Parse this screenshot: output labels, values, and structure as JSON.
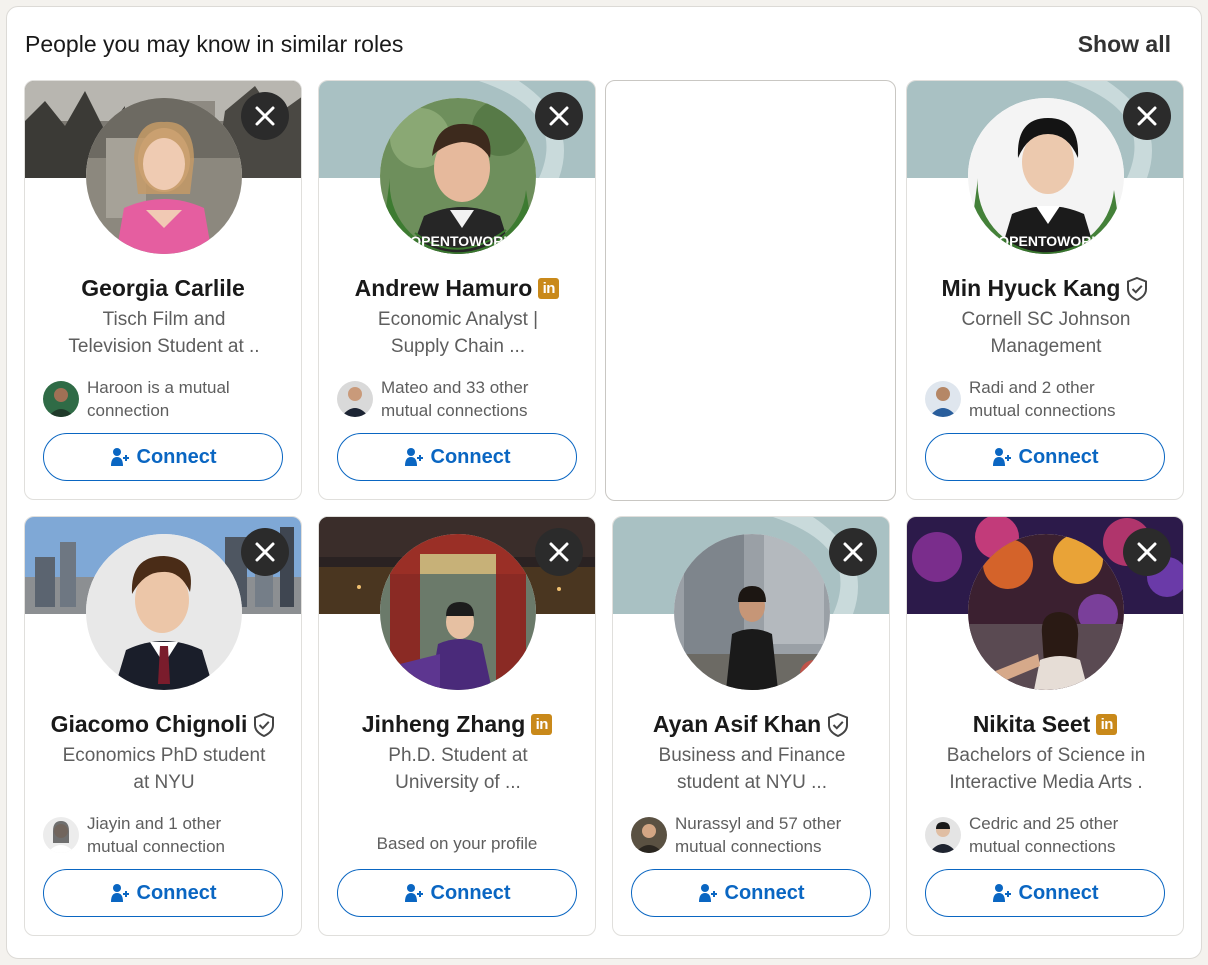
{
  "header": {
    "title": "People you may know in similar roles",
    "show_all_label": "Show all"
  },
  "cards": [
    {
      "name": "Georgia Carlile",
      "badge": "none",
      "headline": [
        "Tisch Film and",
        "Television Student at .."
      ],
      "mutual": [
        "Haroon is a mutual",
        "connection"
      ],
      "connect_label": "Connect"
    },
    {
      "name": "Andrew Hamuro",
      "badge": "linkedin-premium-icon",
      "badge_text": "in",
      "headline": [
        "Economic Analyst |",
        "Supply Chain ..."
      ],
      "mutual": [
        "Mateo and 33 other",
        "mutual connections"
      ],
      "opentowork": "#OPENTOWORK",
      "connect_label": "Connect"
    },
    {
      "name": "Min Hyuck Kang",
      "badge": "verified-shield-icon",
      "headline": [
        "Cornell SC Johnson",
        "Management"
      ],
      "mutual": [
        "Radi and 2 other",
        "mutual connections"
      ],
      "opentowork": "#OPENTOWORK",
      "connect_label": "Connect"
    },
    {
      "name": "Giacomo Chignoli",
      "badge": "verified-shield-icon",
      "headline": [
        "Economics PhD student",
        "at NYU"
      ],
      "mutual": [
        "Jiayin and 1 other",
        "mutual connection"
      ],
      "connect_label": "Connect"
    },
    {
      "name": "Jinheng Zhang",
      "badge": "linkedin-premium-icon",
      "badge_text": "in",
      "headline": [
        "Ph.D. Student at",
        "University of ..."
      ],
      "based_on": "Based on your profile",
      "connect_label": "Connect"
    },
    {
      "name": "Ayan Asif Khan",
      "badge": "verified-shield-icon",
      "headline": [
        "Business and Finance",
        "student at NYU ..."
      ],
      "mutual": [
        "Nurassyl and 57 other",
        "mutual connections"
      ],
      "connect_label": "Connect"
    },
    {
      "name": "Nikita Seet",
      "badge": "linkedin-premium-icon",
      "badge_text": "in",
      "headline": [
        "Bachelors of Science in",
        "Interactive Media Arts ."
      ],
      "mutual": [
        "Cedric and 25 other",
        "mutual connections"
      ],
      "connect_label": "Connect"
    }
  ],
  "colors": {
    "accent": "#0a66c2",
    "premium": "#c9891a",
    "opentowork": "#3a7a2e",
    "banner_default": "#a9c1c3"
  }
}
